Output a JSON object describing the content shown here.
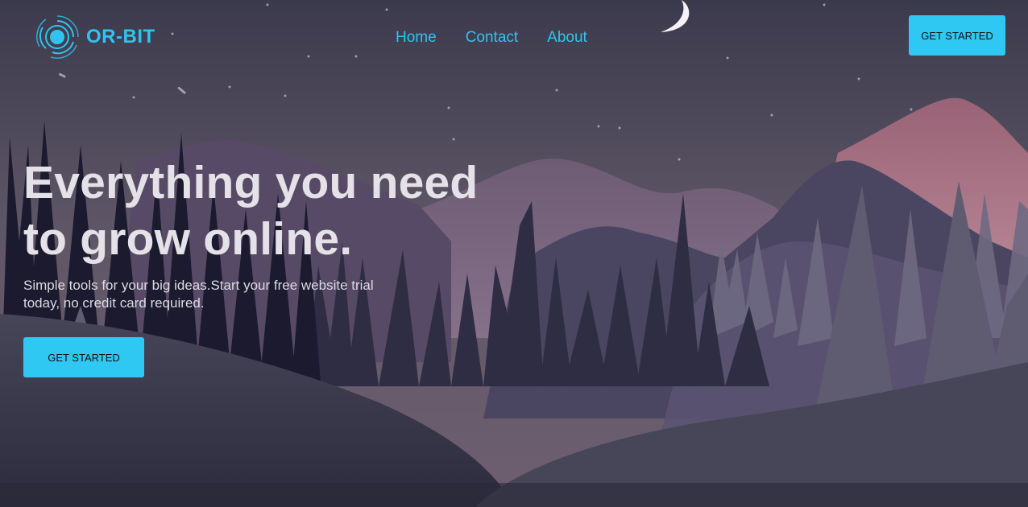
{
  "brand": {
    "name": "OR-BIT",
    "logo_icon": "orbit-rings-icon",
    "color": "#2fc4f0"
  },
  "nav": {
    "items": [
      {
        "label": "Home"
      },
      {
        "label": "Contact"
      },
      {
        "label": "About"
      }
    ]
  },
  "header": {
    "cta_label": "GET STARTED"
  },
  "hero": {
    "headline_line1": "Everything you need",
    "headline_line2": "to grow online.",
    "subtitle": "Simple tools for your big ideas.Start your free website trial today, no credit card required.",
    "cta_label": "GET STARTED"
  },
  "colors": {
    "accent": "#2fc8f2",
    "sky_top": "#3c3a4c",
    "sky_bottom": "#6a5c6e",
    "peak_pink": "#a0667a"
  },
  "icons": {
    "moon": "crescent-moon-icon"
  }
}
